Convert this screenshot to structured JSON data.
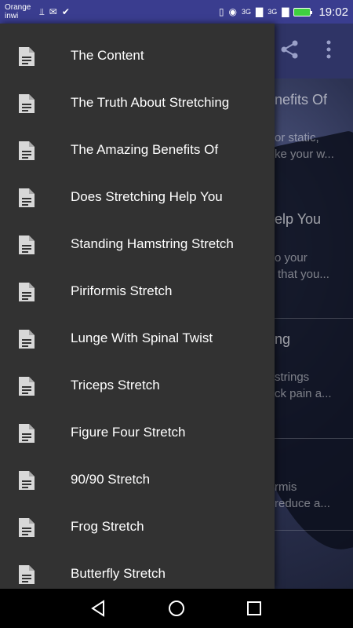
{
  "status_bar": {
    "carrier_line1": "Orange",
    "carrier_line2": "inwi",
    "time": "19:02",
    "signal_1": "3G",
    "signal_2": "3G",
    "icons": [
      "usb-icon",
      "mail-icon",
      "check-icon",
      "vibrate-icon",
      "eye-icon",
      "signal-icon",
      "battery-icon"
    ],
    "battery_color": "#3fd13f"
  },
  "background": {
    "toolbar_icons": [
      "share-icon",
      "more-vert-icon"
    ],
    "texts": [
      {
        "text": "nefits Of",
        "style": "head"
      },
      {
        "text": "or static,",
        "style": "body"
      },
      {
        "text": "ke your w...",
        "style": "body"
      },
      {
        "text": "elp You",
        "style": "head"
      },
      {
        "text": "o your",
        "style": "body"
      },
      {
        "text": "that you...",
        "style": "body"
      },
      {
        "text": "ng",
        "style": "head"
      },
      {
        "text": "strings",
        "style": "body"
      },
      {
        "text": "ck pain a...",
        "style": "body"
      },
      {
        "text": "rmis",
        "style": "body"
      },
      {
        "text": "reduce a...",
        "style": "body"
      }
    ]
  },
  "drawer": {
    "background": "#323232",
    "items": [
      {
        "label": "The Content"
      },
      {
        "label": "The Truth About Stretching"
      },
      {
        "label": "The Amazing Benefits Of"
      },
      {
        "label": "Does Stretching Help You"
      },
      {
        "label": "Standing Hamstring Stretch"
      },
      {
        "label": "Piriformis Stretch"
      },
      {
        "label": "Lunge With Spinal Twist"
      },
      {
        "label": "Triceps Stretch"
      },
      {
        "label": "Figure Four Stretch"
      },
      {
        "label": "90/90 Stretch"
      },
      {
        "label": "Frog Stretch"
      },
      {
        "label": "Butterfly Stretch"
      }
    ]
  },
  "nav_bar": {
    "buttons": [
      "back-icon",
      "home-icon",
      "recents-icon"
    ]
  }
}
